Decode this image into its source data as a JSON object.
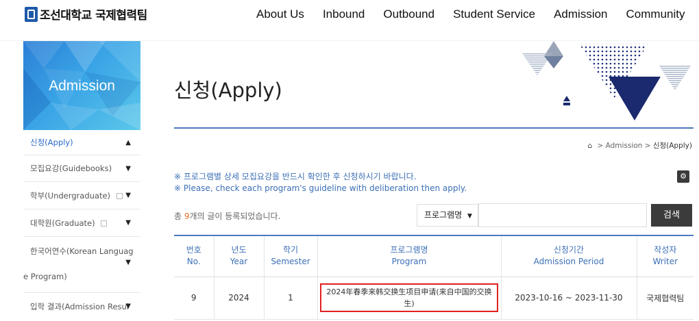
{
  "header": {
    "logo_text": "조선대학교 국제협력팀",
    "nav": [
      "About Us",
      "Inbound",
      "Outbound",
      "Student Service",
      "Admission",
      "Community"
    ]
  },
  "sidebar": {
    "banner_title": "Admission",
    "items": [
      {
        "label": "신청(Apply)",
        "chevron": "^",
        "active": true
      },
      {
        "label": "모집요강(Guidebooks)",
        "chevron": "v"
      },
      {
        "label": "학부(Undergraduate)",
        "chevron": "v",
        "external": true
      },
      {
        "label": "대학원(Graduate)",
        "chevron": "v",
        "external": true
      },
      {
        "label": "한국어연수(Korean Language Program)",
        "line1": "한국어연수(Korean Languag",
        "line2": "e Program)",
        "chevron": "v"
      },
      {
        "label": "입학 결과(Admission Results)",
        "display": "입학 결과(Admission Resul",
        "chevron": "v"
      }
    ]
  },
  "main": {
    "title": "신청(Apply)",
    "breadcrumb": {
      "middle": "Admission",
      "current": "신청(Apply)"
    },
    "notice_kr": "※ 프로그램별 상세 모집요강을 반드시 확인한 후 신청하시기 바랍니다.",
    "notice_en": "※ Please, check each program's guideline with deliberation then apply.",
    "count_prefix": "총 ",
    "count_num": "9",
    "count_suffix": "개의 글이 등록되었습니다.",
    "search": {
      "select_value": "프로그램명",
      "placeholder": "",
      "button": "검색"
    }
  },
  "table": {
    "headers": [
      {
        "kr": "번호",
        "en": "No."
      },
      {
        "kr": "년도",
        "en": "Year"
      },
      {
        "kr": "학기",
        "en": "Semester"
      },
      {
        "kr": "프로그램명",
        "en": "Program"
      },
      {
        "kr": "신청기간",
        "en": "Admission Period"
      },
      {
        "kr": "작성자",
        "en": "Writer"
      }
    ],
    "rows": [
      {
        "no": "9",
        "year": "2024",
        "semester": "1",
        "program": "2024年春季来韩交换生项目申请(来自中国的交换生)",
        "period": "2023-10-16 ~ 2023-11-30",
        "writer": "국제협력팀"
      }
    ]
  },
  "colors": {
    "accent": "#3b6fb6",
    "highlight": "#e02020",
    "count": "#e0702a",
    "dark_button": "#3b3b3b"
  },
  "icons": [
    "home-icon",
    "settings-icon",
    "external-link-icon",
    "chevron-down-icon",
    "chevron-up-icon"
  ]
}
